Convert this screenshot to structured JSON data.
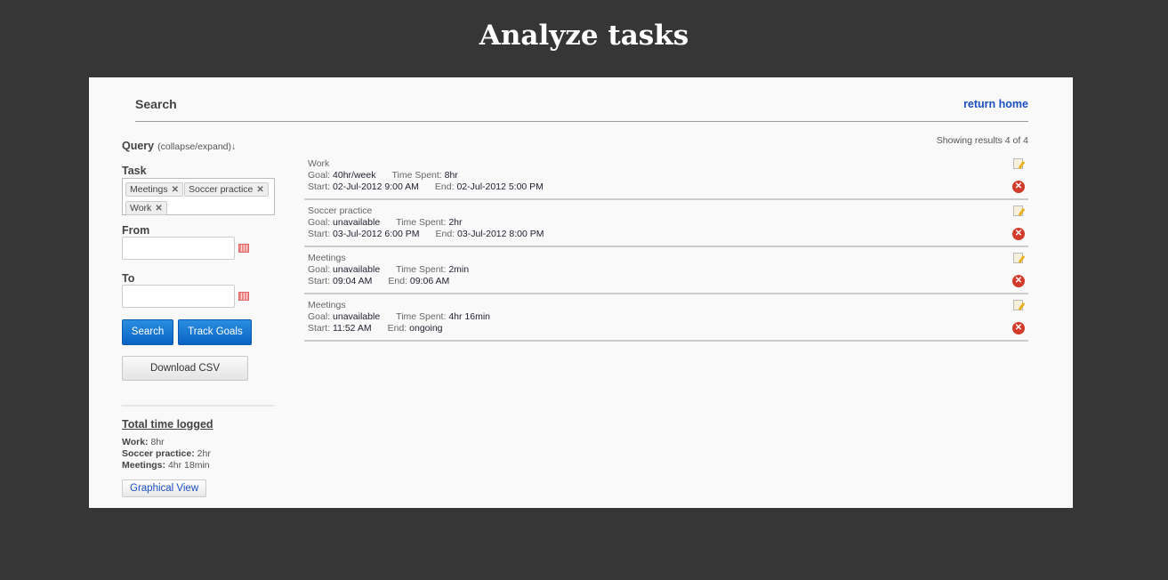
{
  "title": "Analyze tasks",
  "header": {
    "title": "Search",
    "return_home": "return home"
  },
  "query": {
    "label": "Query",
    "toggle": "(collapse/expand)↓",
    "task_label": "Task",
    "tags": [
      "Meetings",
      "Soccer practice",
      "Work"
    ],
    "from_label": "From",
    "from_value": "",
    "to_label": "To",
    "to_value": "",
    "search": "Search",
    "track_goals": "Track Goals",
    "download_csv": "Download CSV"
  },
  "summary": {
    "title": "Total time logged",
    "items": [
      {
        "name": "Work:",
        "value": "8hr"
      },
      {
        "name": "Soccer practice:",
        "value": "2hr"
      },
      {
        "name": "Meetings:",
        "value": "4hr 18min"
      }
    ],
    "graphical_view": "Graphical View"
  },
  "results": {
    "count": "Showing results 4 of 4",
    "labels": {
      "goal": "Goal:",
      "spent": "Time Spent:",
      "start": "Start:",
      "end": "End:"
    },
    "rows": [
      {
        "task": "Work",
        "goal": "40hr/week",
        "spent": "8hr",
        "start": "02-Jul-2012 9:00 AM",
        "end": "02-Jul-2012 5:00 PM"
      },
      {
        "task": "Soccer practice",
        "goal": "unavailable",
        "spent": "2hr",
        "start": "03-Jul-2012 6:00 PM",
        "end": "03-Jul-2012 8:00 PM"
      },
      {
        "task": "Meetings",
        "goal": "unavailable",
        "spent": "2min",
        "start": "09:04 AM",
        "end": "09:06 AM"
      },
      {
        "task": "Meetings",
        "goal": "unavailable",
        "spent": "4hr 16min",
        "start": "11:52 AM",
        "end": "ongoing"
      }
    ]
  },
  "colors": {
    "background": "#363636",
    "panel": "#f9f9f9",
    "link": "#1a4fc4",
    "button": "#0a63c4",
    "delete": "#d23a2a"
  }
}
